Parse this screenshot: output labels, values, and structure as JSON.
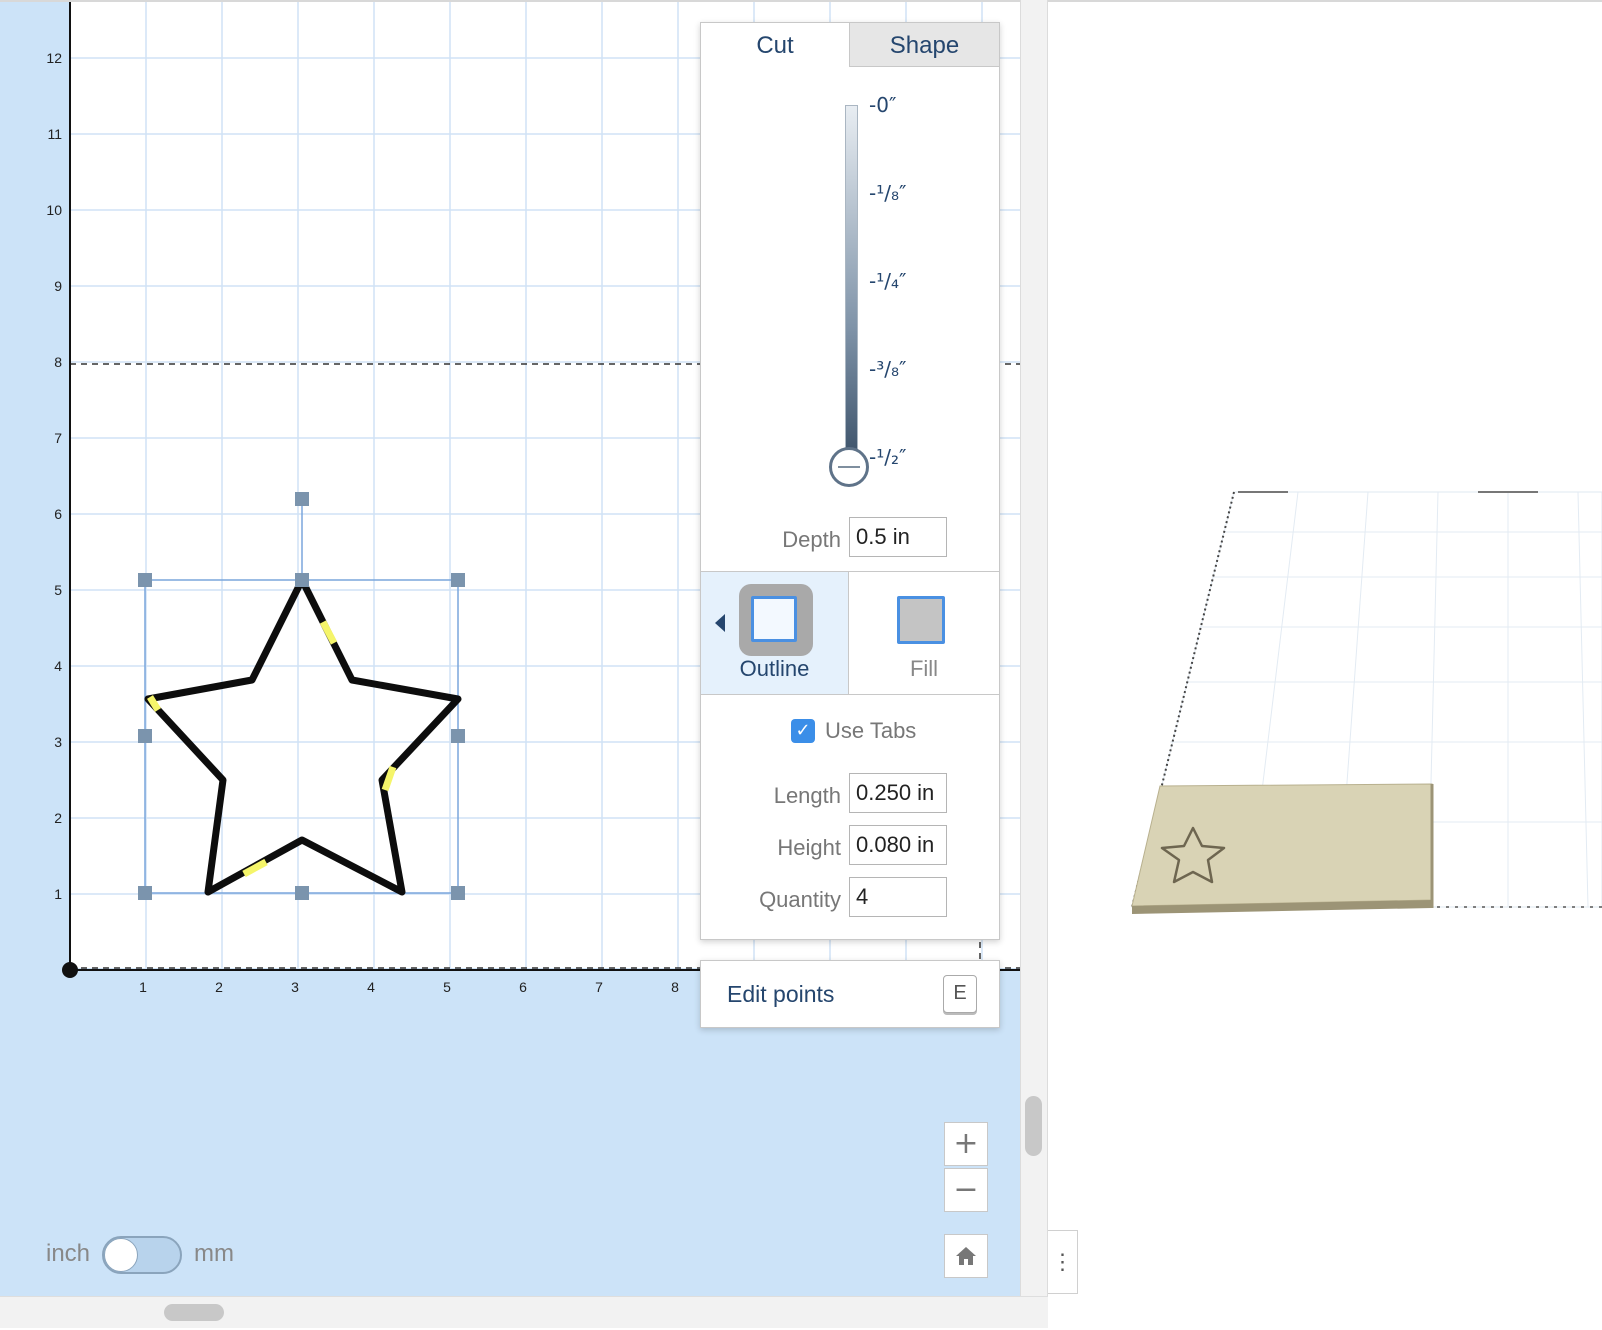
{
  "canvas": {
    "y_axis_labels": [
      "12",
      "11",
      "10",
      "9",
      "8",
      "7",
      "6",
      "5",
      "4",
      "3",
      "2",
      "1"
    ],
    "x_axis_labels": [
      "1",
      "2",
      "3",
      "4",
      "5",
      "6",
      "7",
      "8"
    ],
    "background_color": "#cce3f8",
    "grid_color": "#d0e2f5"
  },
  "panel": {
    "tabs": {
      "cut": "Cut",
      "shape": "Shape"
    },
    "depth_marks": [
      "-0″",
      "-¹/₈″",
      "-¹/₄″",
      "-³/₈″",
      "-¹/₂″"
    ],
    "depth": {
      "label": "Depth",
      "value": "0.5 in"
    },
    "modes": {
      "outline": "Outline",
      "fill": "Fill",
      "selected": "Outline"
    },
    "use_tabs": {
      "label": "Use Tabs",
      "checked": true
    },
    "tab_length": {
      "label": "Length",
      "value": "0.250 in"
    },
    "tab_height": {
      "label": "Height",
      "value": "0.080 in"
    },
    "tab_quantity": {
      "label": "Quantity",
      "value": "4"
    }
  },
  "edit_points": {
    "label": "Edit points",
    "shortcut": "E"
  },
  "zoom": {
    "in": "+",
    "out": "−"
  },
  "units": {
    "left": "inch",
    "right": "mm",
    "selected": "inch"
  },
  "preview_menu": "⋮",
  "colors": {
    "accent": "#4a90e2",
    "panel_text": "#25466e",
    "tab_highlight": "#f5f56a"
  }
}
